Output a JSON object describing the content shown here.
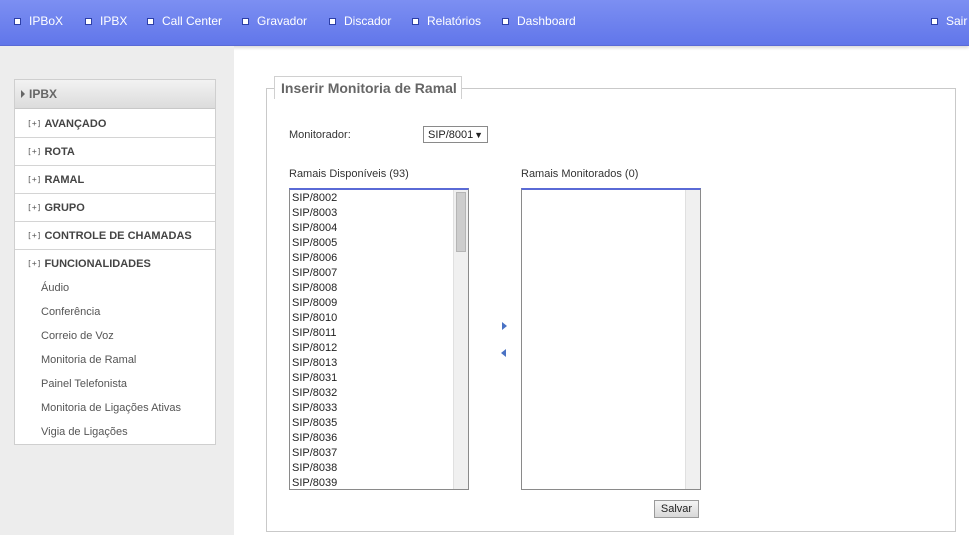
{
  "nav": {
    "items": [
      "IPBoX",
      "IPBX",
      "Call Center",
      "Gravador",
      "Discador",
      "Relatórios",
      "Dashboard"
    ],
    "logout": "Sair"
  },
  "sidebar": {
    "header": "IPBX",
    "expander_symbol": "[+]",
    "sections": [
      "AVANÇADO",
      "ROTA",
      "RAMAL",
      "GRUPO",
      "CONTROLE DE CHAMADAS",
      "FUNCIONALIDADES"
    ],
    "subitems": [
      "Áudio",
      "Conferência",
      "Correio de Voz",
      "Monitoria de Ramal",
      "Painel Telefonista",
      "Monitoria de Ligações Ativas",
      "Vigia de Ligações"
    ]
  },
  "form": {
    "title": "Inserir Monitoria de Ramal",
    "monitor_label": "Monitorador:",
    "monitor_value": "SIP/8001",
    "available_label": "Ramais Disponíveis (93)",
    "monitored_label": "Ramais Monitorados (0)",
    "available_items": [
      "SIP/8002",
      "SIP/8003",
      "SIP/8004",
      "SIP/8005",
      "SIP/8006",
      "SIP/8007",
      "SIP/8008",
      "SIP/8009",
      "SIP/8010",
      "SIP/8011",
      "SIP/8012",
      "SIP/8013",
      "SIP/8031",
      "SIP/8032",
      "SIP/8033",
      "SIP/8035",
      "SIP/8036",
      "SIP/8037",
      "SIP/8038",
      "SIP/8039"
    ],
    "monitored_items": [],
    "save_label": "Salvar"
  },
  "colors": {
    "nav_bg": "#6f82ef",
    "accent": "#4a72c4"
  }
}
